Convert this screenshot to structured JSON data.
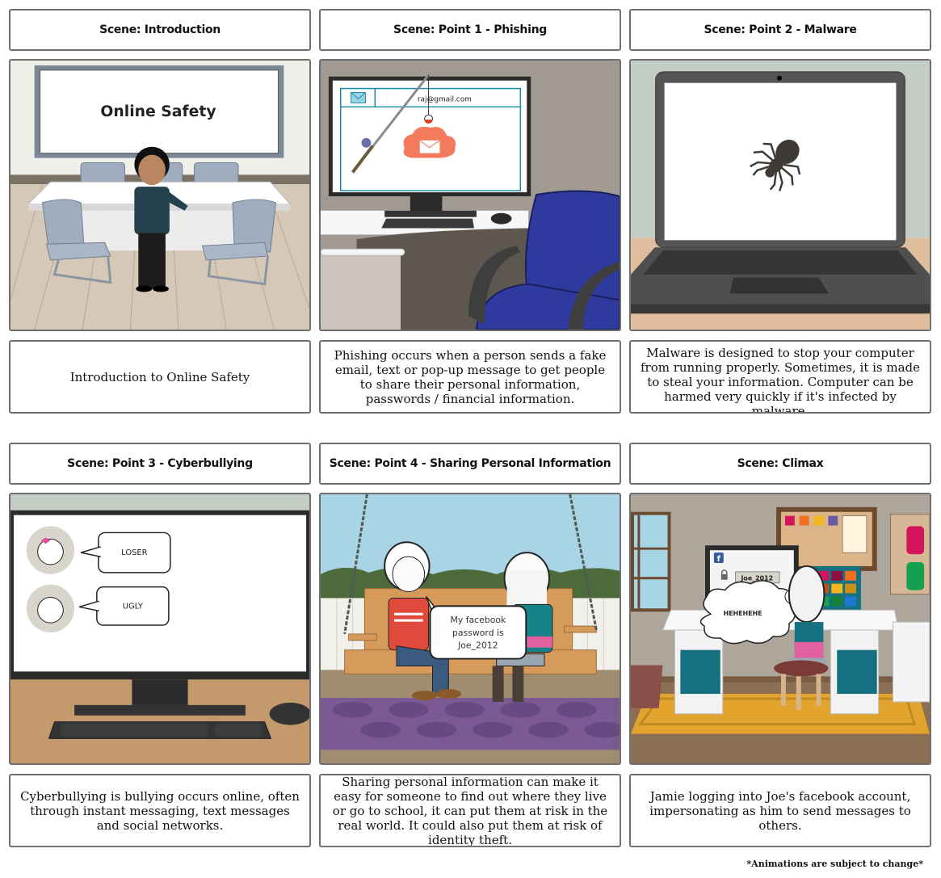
{
  "storyboard": {
    "scenes": [
      {
        "title": "Scene: Introduction",
        "description": "Introduction to Online Safety",
        "image": {
          "whiteboard_text": "Online Safety"
        }
      },
      {
        "title": "Scene: Point 1 - Phishing",
        "description": "Phishing occurs when a person sends a fake email, text or pop-up message to get people to share their personal information, passwords / financial information.",
        "image": {
          "email_address": "raj@gmail.com"
        }
      },
      {
        "title": "Scene: Point 2 - Malware",
        "description": "Malware is designed to stop your computer from running properly. Sometimes, it is made to steal your information. Computer can be harmed very quickly if it's infected by malware.",
        "image": {}
      },
      {
        "title": "Scene: Point 3 - Cyberbullying",
        "description": "Cyberbullying is bullying occurs online, often through instant messaging, text messages and social networks.",
        "image": {
          "messages": [
            "LOSER",
            "UGLY"
          ]
        }
      },
      {
        "title": "Scene: Point 4 - Sharing Personal Information",
        "description": "Sharing personal information can make it easy for someone to find out where they live or go to school, it can put them at risk in the real world. It could also put them at risk of identity theft.",
        "image": {
          "speech_lines": [
            "My facebook",
            "password is",
            "Joe_2012"
          ]
        }
      },
      {
        "title": "Scene: Climax",
        "description": "Jamie logging into Joe's facebook account, impersonating as him to send messages to others.",
        "image": {
          "password_field": "Joe_2012",
          "thought": "HEHEHEHE"
        }
      }
    ],
    "footer_note": "*Animations are subject to change*"
  }
}
